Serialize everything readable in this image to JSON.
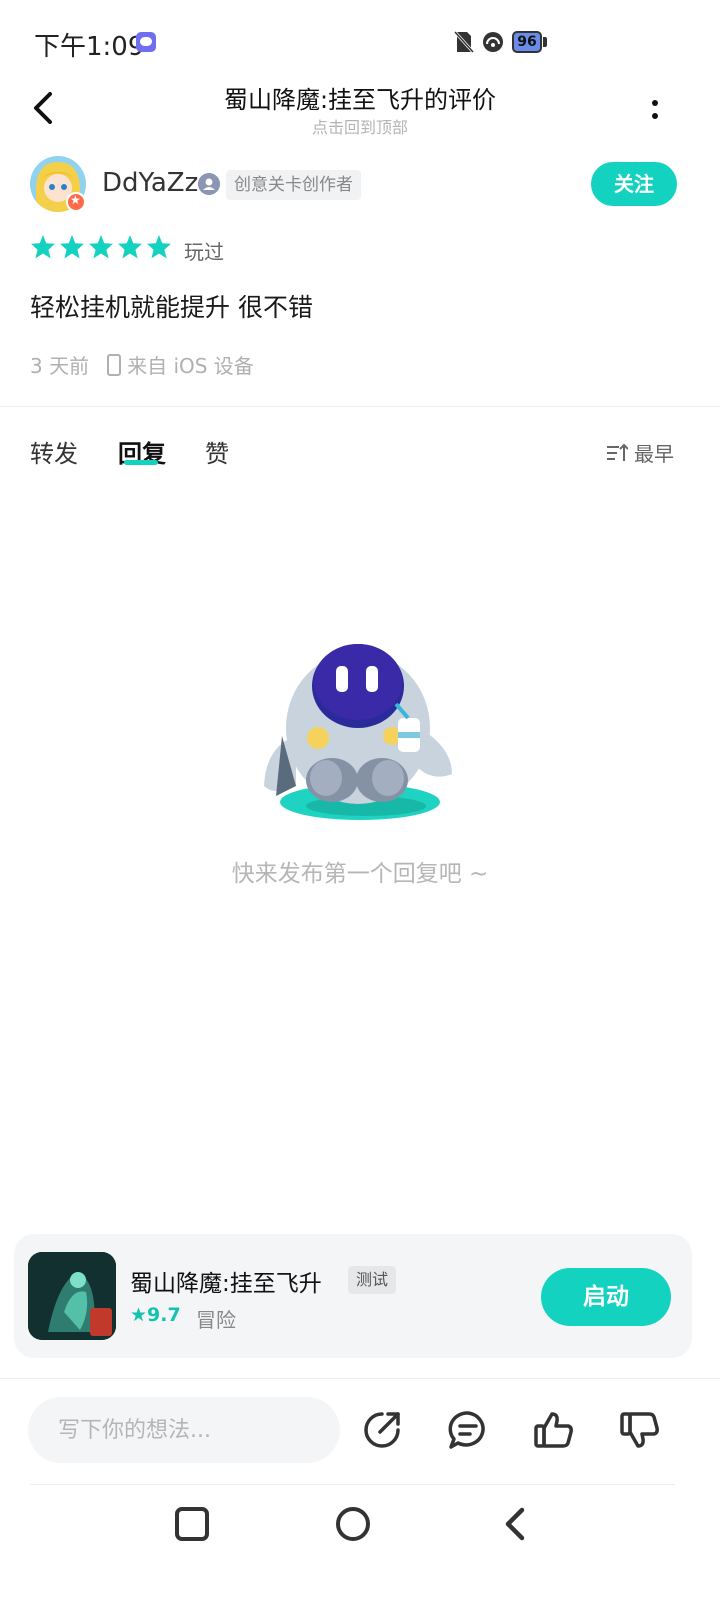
{
  "status_bar": {
    "time": "下午1:09",
    "battery": "96"
  },
  "header": {
    "title": "蜀山降魔:挂至飞升的评价",
    "subtitle": "点击回到顶部"
  },
  "author": {
    "username": "DdYaZz",
    "badge": "创意关卡创作者",
    "follow_label": "关注"
  },
  "review": {
    "rating": 5,
    "rating_max": 5,
    "played_label": "玩过",
    "text": "轻松挂机就能提升 很不错",
    "time": "3 天前",
    "source": "来自 iOS 设备"
  },
  "tabs": [
    {
      "label": "转发",
      "active": false
    },
    {
      "label": "回复",
      "active": true
    },
    {
      "label": "赞",
      "active": false
    }
  ],
  "sort_label": "最早",
  "empty_state": {
    "text": "快来发布第一个回复吧 ~"
  },
  "game": {
    "name": "蜀山降魔:挂至飞升",
    "tag": "测试",
    "rating": "9.7",
    "genre": "冒险",
    "launch_label": "启动"
  },
  "bottom_bar": {
    "input_placeholder": "写下你的想法...",
    "icons": [
      "share-icon",
      "comment-icon",
      "like-icon",
      "dislike-icon"
    ]
  },
  "colors": {
    "accent": "#14d2c0",
    "star": "#14d2c0",
    "secondary_text": "#b0b0b0"
  }
}
